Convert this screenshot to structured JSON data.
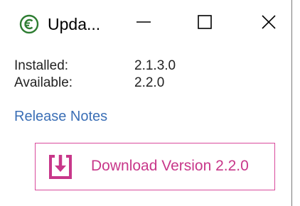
{
  "window": {
    "title": "Upda...",
    "app_icon": "euro-refresh-icon",
    "accent_color": "#c8378a",
    "icon_color": "#2e7d32"
  },
  "titlebar_buttons": {
    "minimize": "minimize-icon",
    "maximize": "maximize-icon",
    "close": "close-icon"
  },
  "info": {
    "installed_label": "Installed:",
    "installed_value": "2.1.3.0",
    "available_label": "Available:",
    "available_value": "2.2.0"
  },
  "links": {
    "release_notes": "Release Notes"
  },
  "download": {
    "label": "Download Version 2.2.0",
    "icon": "download-icon"
  }
}
